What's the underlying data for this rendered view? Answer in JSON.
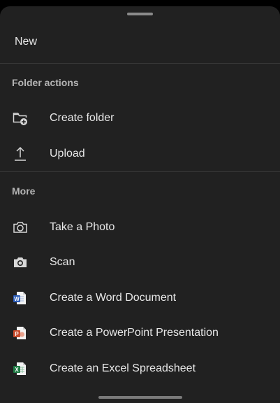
{
  "sheet": {
    "title": "New"
  },
  "sections": {
    "folder_actions": {
      "header": "Folder actions",
      "items": [
        {
          "label": "Create folder",
          "icon": "folder-add-icon"
        },
        {
          "label": "Upload",
          "icon": "upload-icon"
        }
      ]
    },
    "more": {
      "header": "More",
      "items": [
        {
          "label": "Take a Photo",
          "icon": "camera-outline-icon"
        },
        {
          "label": "Scan",
          "icon": "camera-filled-icon"
        },
        {
          "label": "Create a Word Document",
          "icon": "word-doc-icon",
          "badge": "W"
        },
        {
          "label": "Create a PowerPoint Presentation",
          "icon": "powerpoint-doc-icon",
          "badge": "P"
        },
        {
          "label": "Create an Excel Spreadsheet",
          "icon": "excel-doc-icon",
          "badge": "X"
        }
      ]
    }
  },
  "colors": {
    "sheet_bg": "#212121",
    "text": "#e8e8e8",
    "header_text": "#b5b5b5",
    "word": "#2b5cb8",
    "powerpoint": "#c84a2b",
    "excel": "#1f7a44"
  }
}
